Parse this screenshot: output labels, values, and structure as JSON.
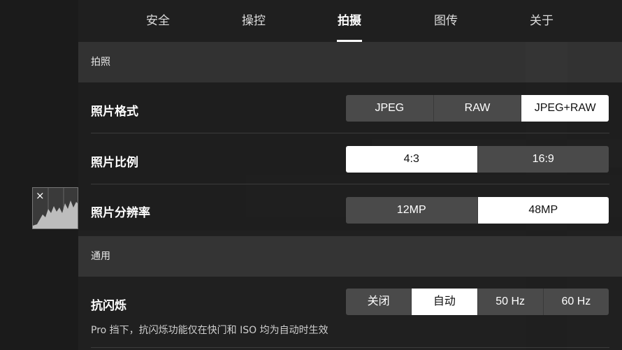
{
  "tabs": [
    {
      "label": "安全",
      "active": false
    },
    {
      "label": "操控",
      "active": false
    },
    {
      "label": "拍摄",
      "active": true
    },
    {
      "label": "图传",
      "active": false
    },
    {
      "label": "关于",
      "active": false
    }
  ],
  "sections": {
    "photo": {
      "title": "拍照"
    },
    "general": {
      "title": "通用"
    }
  },
  "settings": {
    "photo_format": {
      "label": "照片格式",
      "options": [
        "JPEG",
        "RAW",
        "JPEG+RAW"
      ],
      "selected": "JPEG+RAW"
    },
    "aspect_ratio": {
      "label": "照片比例",
      "options": [
        "4:3",
        "16:9"
      ],
      "selected": "4:3"
    },
    "resolution": {
      "label": "照片分辨率",
      "options": [
        "12MP",
        "48MP"
      ],
      "selected": "48MP"
    },
    "anti_flicker": {
      "label": "抗闪烁",
      "options": [
        "关闭",
        "自动",
        "50 Hz",
        "60 Hz"
      ],
      "selected": "自动",
      "hint": "Pro 挡下，抗闪烁功能仅在快门和 ISO 均为自动时生效"
    }
  },
  "histogram": {
    "close_icon": "×"
  },
  "colors": {
    "selected_bg": "#ffffff",
    "unselected_bg": "#4a4a4a",
    "panel_bg": "#252525"
  }
}
